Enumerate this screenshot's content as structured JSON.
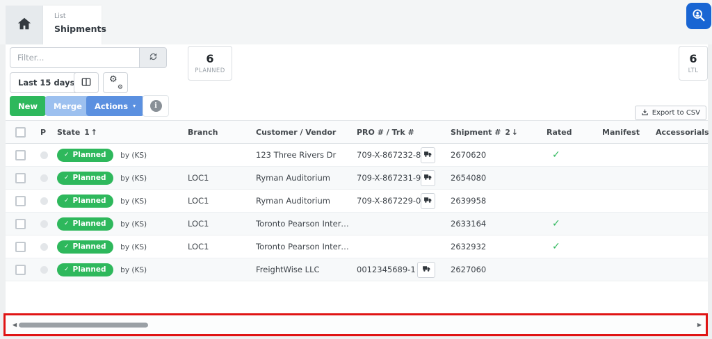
{
  "tabs": {
    "active": {
      "kicker": "List",
      "title": "Shipments"
    }
  },
  "toolbar": {
    "filter": {
      "placeholder": "Filter..."
    },
    "date_range": {
      "label": "Last 15 days"
    },
    "buttons": {
      "new": "New",
      "merge": "Merge",
      "actions": "Actions"
    },
    "export": {
      "label": "Export to CSV"
    }
  },
  "summary_cards": {
    "planned": {
      "value": "6",
      "label": "PLANNED"
    },
    "ltl": {
      "value": "6",
      "label": "LTL"
    }
  },
  "table": {
    "headers": {
      "p": "P",
      "state": {
        "label": "State",
        "sort_order": "1",
        "sort_dir_icon": "↑"
      },
      "branch": "Branch",
      "customer": "Customer / Vendor",
      "pro": "PRO # / Trk #",
      "shipment": {
        "label": "Shipment #",
        "sort_order": "2",
        "sort_dir_icon": "↓"
      },
      "rated": "Rated",
      "manifest": "Manifest",
      "accessorials": "Accessorials"
    },
    "rows": [
      {
        "state": "Planned",
        "by": "by (KS)",
        "branch": "",
        "customer": "123 Three Rivers Dr",
        "pro": "709-X-867232-8",
        "has_pro_icon": true,
        "shipment": "2670620",
        "rated": "✓"
      },
      {
        "state": "Planned",
        "by": "by (KS)",
        "branch": "LOC1",
        "customer": "Ryman Auditorium",
        "pro": "709-X-867231-9",
        "has_pro_icon": true,
        "shipment": "2654080",
        "rated": ""
      },
      {
        "state": "Planned",
        "by": "by (KS)",
        "branch": "LOC1",
        "customer": "Ryman Auditorium",
        "pro": "709-X-867229-0",
        "has_pro_icon": true,
        "shipment": "2639958",
        "rated": ""
      },
      {
        "state": "Planned",
        "by": "by (KS)",
        "branch": "LOC1",
        "customer": "Toronto Pearson Internati…",
        "pro": "",
        "has_pro_icon": false,
        "shipment": "2633164",
        "rated": "✓"
      },
      {
        "state": "Planned",
        "by": "by (KS)",
        "branch": "LOC1",
        "customer": "Toronto Pearson Internati…",
        "pro": "",
        "has_pro_icon": false,
        "shipment": "2632932",
        "rated": "✓"
      },
      {
        "state": "Planned",
        "by": "by (KS)",
        "branch": "",
        "customer": "FreightWise LLC",
        "pro": "0012345689-1",
        "has_pro_icon": true,
        "shipment": "2627060",
        "rated": ""
      }
    ]
  },
  "icons": {
    "check": "✓",
    "caret_down": "▾",
    "info": "i",
    "gear": "⚙",
    "scroll_left": "◀",
    "scroll_right": "▶"
  },
  "colors": {
    "badge_green": "#2eb85c",
    "actions_blue": "#5b90e0",
    "merge_blue": "#9cc0ef",
    "search_button_blue": "#1865d3",
    "highlight_red": "#e01414"
  }
}
